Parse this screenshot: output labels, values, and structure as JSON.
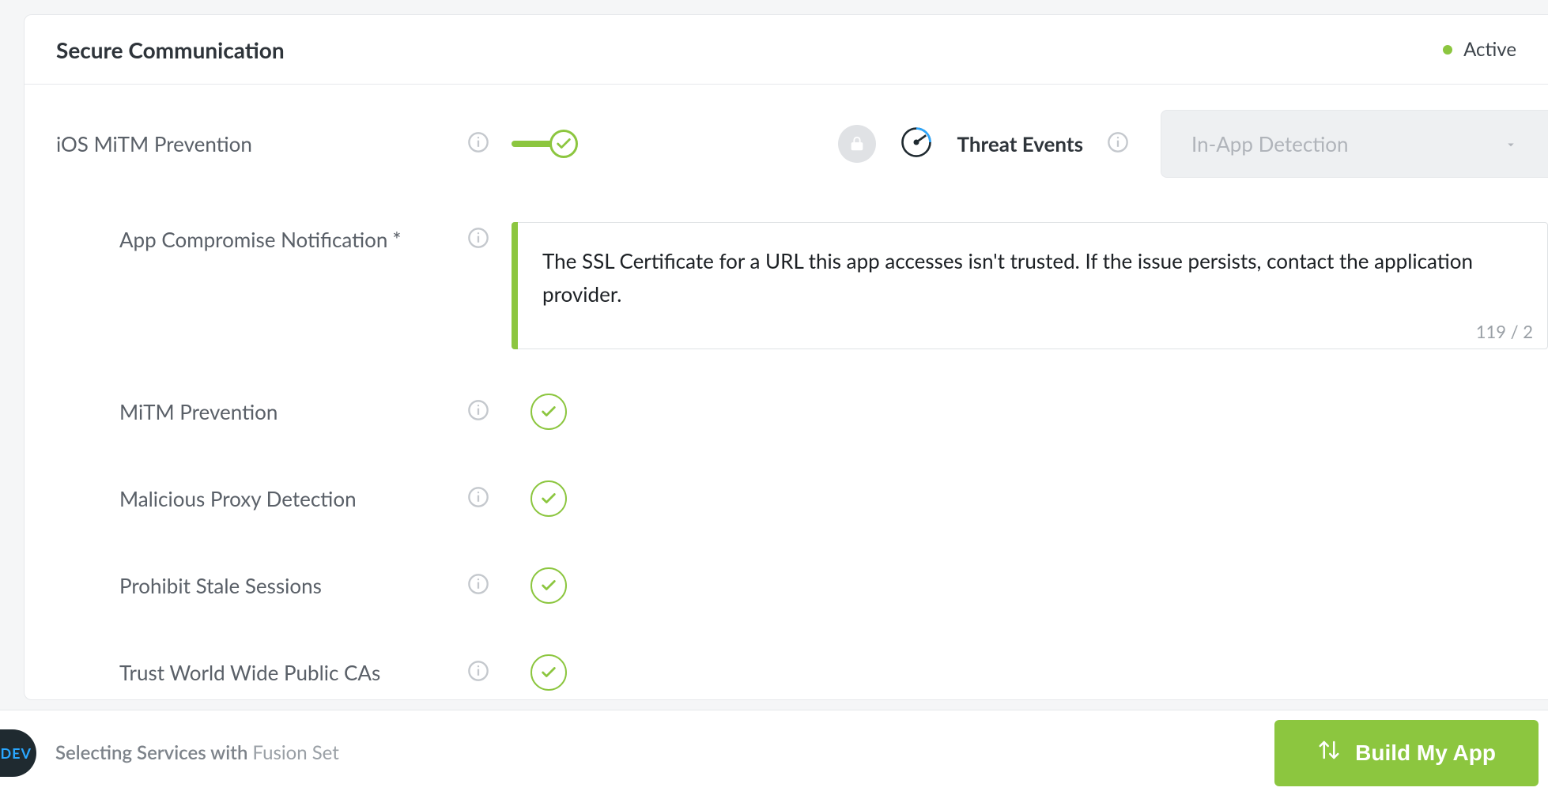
{
  "card": {
    "title": "Secure Communication",
    "status_label": "Active",
    "status_color": "#8cc63f"
  },
  "main_feature": {
    "name": "iOS MiTM Prevention",
    "toggle_on": true
  },
  "threat_events": {
    "label": "Threat Events"
  },
  "dropdown": {
    "selected": "In-App Detection"
  },
  "notification_setting": {
    "name": "App Compromise Notification",
    "required_mark": "*",
    "text": "The SSL Certificate for a URL this app accesses isn't trusted. If the issue persists, contact the application provider.",
    "char_counter": "119 / 2"
  },
  "sub_settings": [
    {
      "name": "MiTM Prevention",
      "checked": true
    },
    {
      "name": "Malicious Proxy Detection",
      "checked": true
    },
    {
      "name": "Prohibit Stale Sessions",
      "checked": true
    },
    {
      "name": "Trust World Wide Public CAs",
      "checked": true
    }
  ],
  "footer": {
    "dev_badge": "DEV",
    "text_prefix": "Selecting Services with ",
    "text_suffix": "Fusion Set",
    "build_button": "Build My App"
  }
}
